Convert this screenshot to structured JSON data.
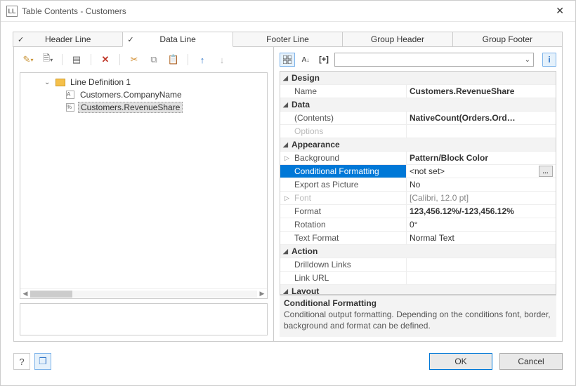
{
  "window": {
    "title": "Table Contents - Customers"
  },
  "tabs": [
    {
      "label": "Header Line",
      "checked": true,
      "active": false
    },
    {
      "label": "Data Line",
      "checked": true,
      "active": true
    },
    {
      "label": "Footer Line",
      "checked": false,
      "active": false
    },
    {
      "label": "Group Header",
      "checked": false,
      "active": false
    },
    {
      "label": "Group Footer",
      "checked": false,
      "active": false
    }
  ],
  "tree": {
    "root": "Line Definition  1",
    "children": [
      {
        "icon": "A",
        "label": "Customers.CompanyName"
      },
      {
        "icon": "%",
        "label": "Customers.RevenueShare"
      }
    ],
    "selected_index": 1
  },
  "propgrid": {
    "categories": [
      {
        "name": "Design",
        "rows": [
          {
            "name": "Name",
            "value": "Customers.RevenueShare",
            "bold": true
          }
        ]
      },
      {
        "name": "Data",
        "rows": [
          {
            "name": "(Contents)",
            "value": "NativeCount(Orders.Ord…",
            "bold": true
          },
          {
            "name": "Options",
            "value": "",
            "dim": true
          }
        ]
      },
      {
        "name": "Appearance",
        "rows": [
          {
            "name": "Background",
            "value": "Pattern/Block Color",
            "bold": true,
            "expandable": true
          },
          {
            "name": "Conditional Formatting",
            "value": "<not set>",
            "selected": true,
            "ellipsis": true
          },
          {
            "name": "Export as Picture",
            "value": "No"
          },
          {
            "name": "Font",
            "value": "[Calibri, 12.0 pt]",
            "dim": true,
            "expandable": true
          },
          {
            "name": "Format",
            "value": "123,456.12%/-123,456.12%",
            "bold": true
          },
          {
            "name": "Rotation",
            "value": "0°"
          },
          {
            "name": "Text Format",
            "value": "Normal Text"
          }
        ]
      },
      {
        "name": "Action",
        "rows": [
          {
            "name": "Drilldown Links",
            "value": ""
          },
          {
            "name": "Link URL",
            "value": ""
          }
        ]
      },
      {
        "name": "Layout",
        "rows": []
      }
    ]
  },
  "description": {
    "title": "Conditional Formatting",
    "text": "Conditional output formatting. Depending on the conditions font, border, background and format can be defined."
  },
  "footer": {
    "ok": "OK",
    "cancel": "Cancel"
  }
}
